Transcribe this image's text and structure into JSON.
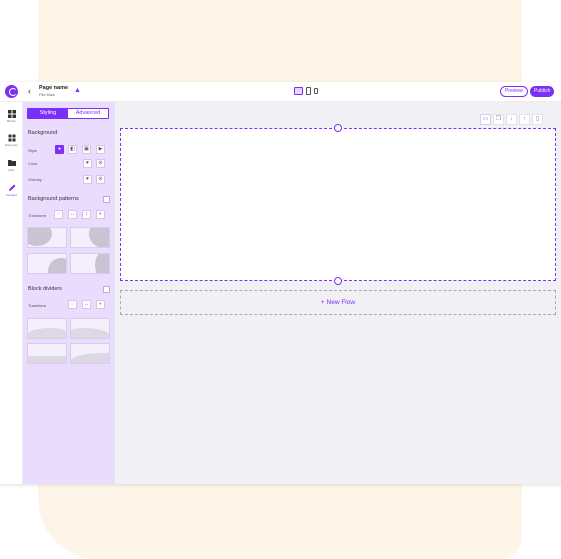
{
  "header": {
    "back_icon": "chevron-left-icon",
    "page_name": "Page name",
    "page_sub": "File  Main",
    "pin_icon": "pin-icon",
    "devices": [
      "desktop-icon",
      "tablet-icon",
      "mobile-icon"
    ],
    "preview_label": "Preview",
    "publish_label": "Publish"
  },
  "rail": {
    "items": [
      {
        "label": "Blocks",
        "icon": "grid-icon"
      },
      {
        "label": "Elements",
        "icon": "elements-icon"
      },
      {
        "label": "Files",
        "icon": "folder-icon"
      },
      {
        "label": "Content",
        "icon": "pen-icon",
        "active": true
      }
    ]
  },
  "panel": {
    "tabs": [
      "Styling",
      "Advanced"
    ],
    "active_tab": "Styling",
    "background_title": "Background",
    "style_label": "Style",
    "color_label": "Color",
    "overlay_label": "Overlay",
    "patterns_title": "Background patterns",
    "transform_label": "Transform",
    "dividers_title": "Block dividers",
    "dividers_transform_label": "Transform"
  },
  "canvas": {
    "new_flow_label": "+ New Flow",
    "toolbar_icons": [
      "image-icon",
      "copy-icon",
      "arrow-down-icon",
      "arrow-up-icon",
      "trash-icon"
    ]
  },
  "colors": {
    "accent": "#7b2ff7",
    "panel_bg": "#e9dcfc",
    "canvas_bg": "#f1f1f5",
    "page_bg": "#fdf6e8"
  }
}
